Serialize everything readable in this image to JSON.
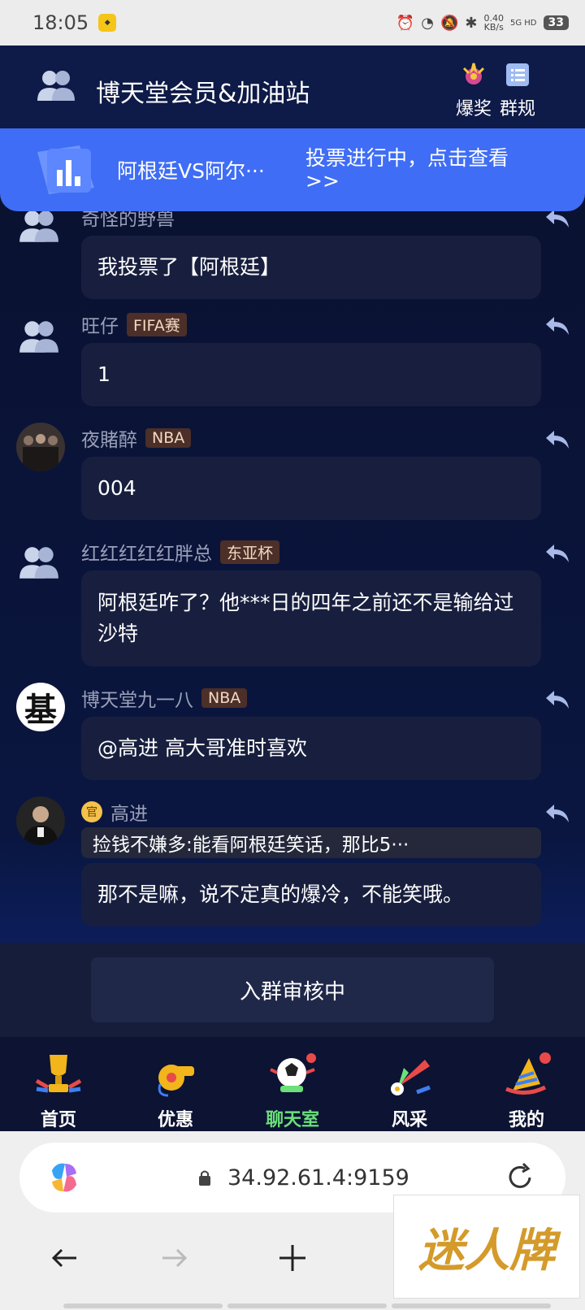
{
  "status": {
    "time": "18:05",
    "speed_value": "0.40",
    "speed_unit": "KB/s",
    "network_top": "5G HD",
    "battery": "33"
  },
  "header": {
    "title": "博天堂会员&加油站",
    "prize_label": "爆奖",
    "rules_label": "群规"
  },
  "vote": {
    "title": "阿根廷VS阿尔···",
    "link": "投票进行中，点击查看>>"
  },
  "messages": [
    {
      "name": "奇怪的野兽",
      "tag": "",
      "text": "我投票了【阿根廷】"
    },
    {
      "name": "旺仔",
      "tag": "FIFA赛",
      "text": "1"
    },
    {
      "name": "夜賭醉",
      "tag": "NBA",
      "text": "004"
    },
    {
      "name": "红红红红红胖总",
      "tag": "东亚杯",
      "text": "阿根廷咋了？他***日的四年之前还不是输给过沙特"
    },
    {
      "name": "博天堂九一八",
      "tag": "NBA",
      "text": "@高进 高大哥准时喜欢"
    },
    {
      "name": "高进",
      "official": "官",
      "quote": "捡钱不嫌多:能看阿根廷笑话，那比5···",
      "text": "那不是嘛，说不定真的爆冷，不能笑哦。"
    }
  ],
  "join": {
    "label": "入群审核中"
  },
  "tabs": [
    {
      "label": "首页"
    },
    {
      "label": "优惠"
    },
    {
      "label": "聊天室"
    },
    {
      "label": "风采"
    },
    {
      "label": "我的"
    }
  ],
  "colors": {
    "accent": "#3f6df5",
    "active_tab": "#6be07a",
    "tag_bg": "#4b2f28"
  },
  "browser": {
    "url": "34.92.61.4:9159"
  },
  "watermark": {
    "text": "迷人牌"
  }
}
